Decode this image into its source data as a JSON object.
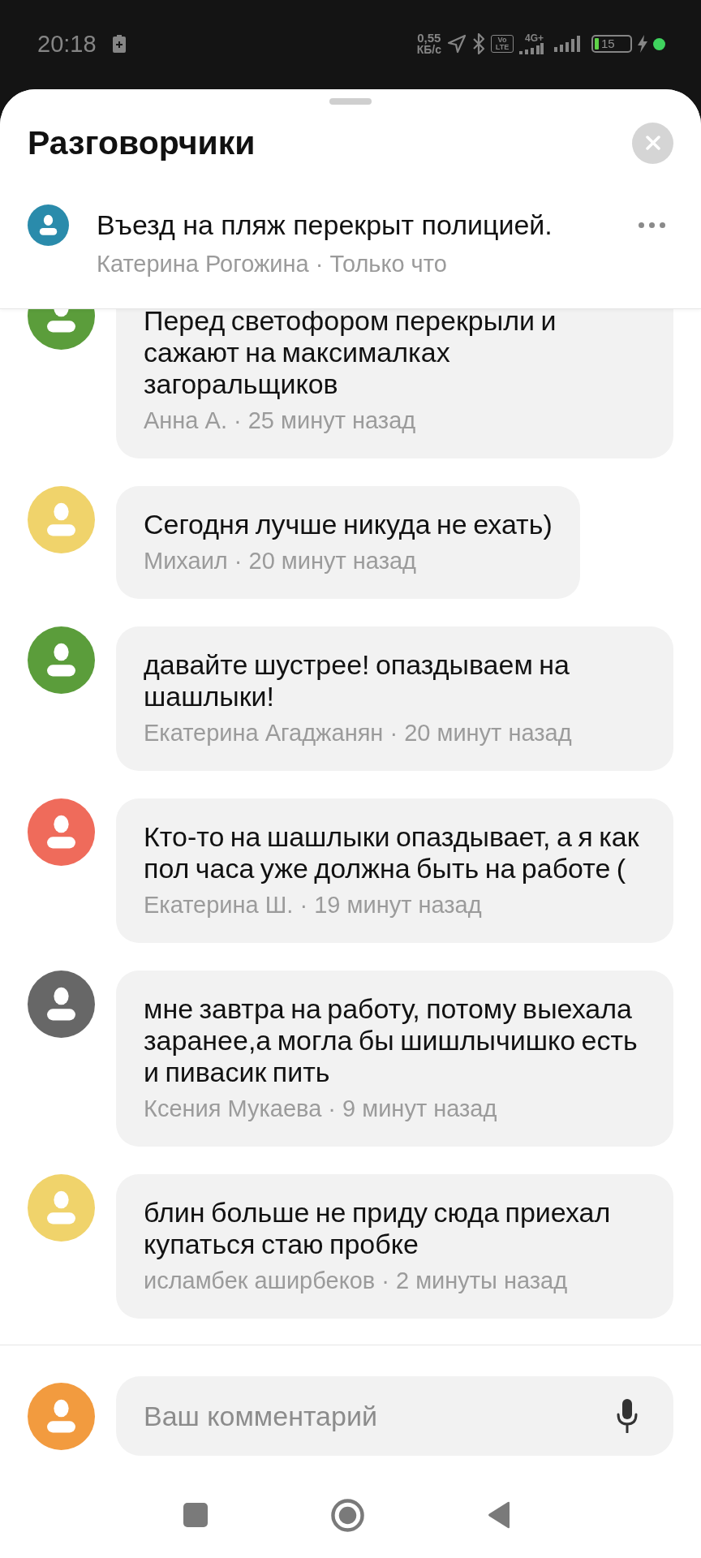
{
  "status_bar": {
    "time": "20:18",
    "net_speed": "0,55",
    "net_speed_unit": "КБ/с",
    "volte": "Vo LTE",
    "network_type": "4G+",
    "battery": "15"
  },
  "sheet": {
    "title": "Разговорчики",
    "pinned": {
      "text": "Въезд на пляж перекрыт полицией.",
      "meta": "Катерина Рогожина · Только что"
    }
  },
  "comments": [
    {
      "text": "Перед светофором перекрыли и сажают на максималках загоральщиков",
      "meta": "Анна А. · 25 минут назад",
      "color": "#5b9d3b"
    },
    {
      "text": "Сегодня лучше никуда не ехать)",
      "meta": "Михаил · 20 минут назад",
      "color": "#f0d36b"
    },
    {
      "text": "давайте шустрее! опаздываем на шашлыки!",
      "meta": "Екатерина Агаджанян · 20 минут назад",
      "color": "#5b9d3b"
    },
    {
      "text": "Кто-то на шашлыки опаздывает, а я как пол часа уже должна быть на работе (",
      "meta": "Екатерина Ш. · 19 минут назад",
      "color": "#ef6b5b"
    },
    {
      "text": "мне завтра на работу, потому выехала заранее,а могла бы шишлычишко есть и пивасик пить",
      "meta": "Ксения Мукаева · 9 минут назад",
      "color": "#676767"
    },
    {
      "text": "блин больше не приду сюда приехал купаться стаю пробке",
      "meta": "исламбек аширбеков · 2 минуты назад",
      "color": "#f0d36b"
    }
  ],
  "composer": {
    "placeholder": "Ваш комментарий"
  }
}
